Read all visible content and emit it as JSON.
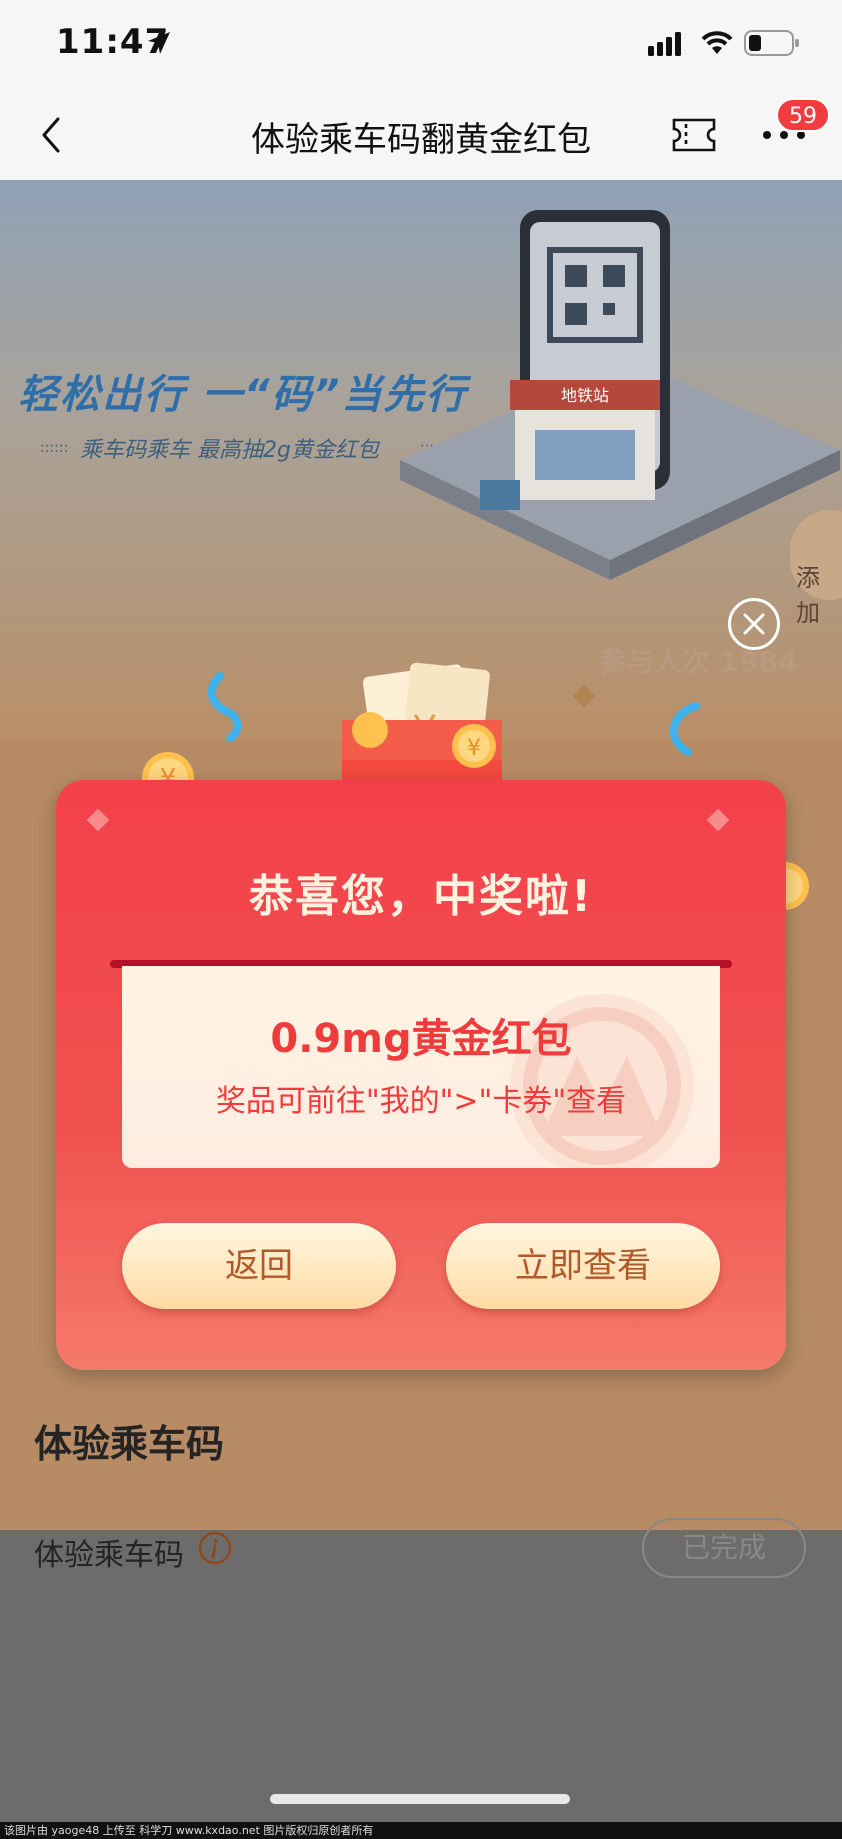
{
  "status_bar": {
    "time": "11:47"
  },
  "nav": {
    "title": "体验乘车码翻黄金红包",
    "badge_count": "59"
  },
  "hero": {
    "headline": "轻松出行 一“码”当先行",
    "subline": "乘车码乘车 最高抽2g黄金红包",
    "station_sign": "地铁站",
    "add_label": "添加",
    "participants": "参与人次 1984"
  },
  "modal": {
    "title": "恭喜您，中奖啦!",
    "prize_name": "0.9mg黄金红包",
    "prize_hint": "奖品可前往\"我的\">\"卡券\"查看",
    "back_label": "返回",
    "view_label": "立即查看"
  },
  "task_section": {
    "title": "体验乘车码",
    "task_label": "体验乘车码",
    "task_status": "已完成"
  },
  "footer": {
    "watermark": "该图片由 yaoge48 上传至 科学刀 www.kxdao.net 图片版权归原创者所有"
  },
  "colors": {
    "primary_red": "#f3404a",
    "button_gold": "#ffdba4",
    "button_text": "#b0592a"
  }
}
